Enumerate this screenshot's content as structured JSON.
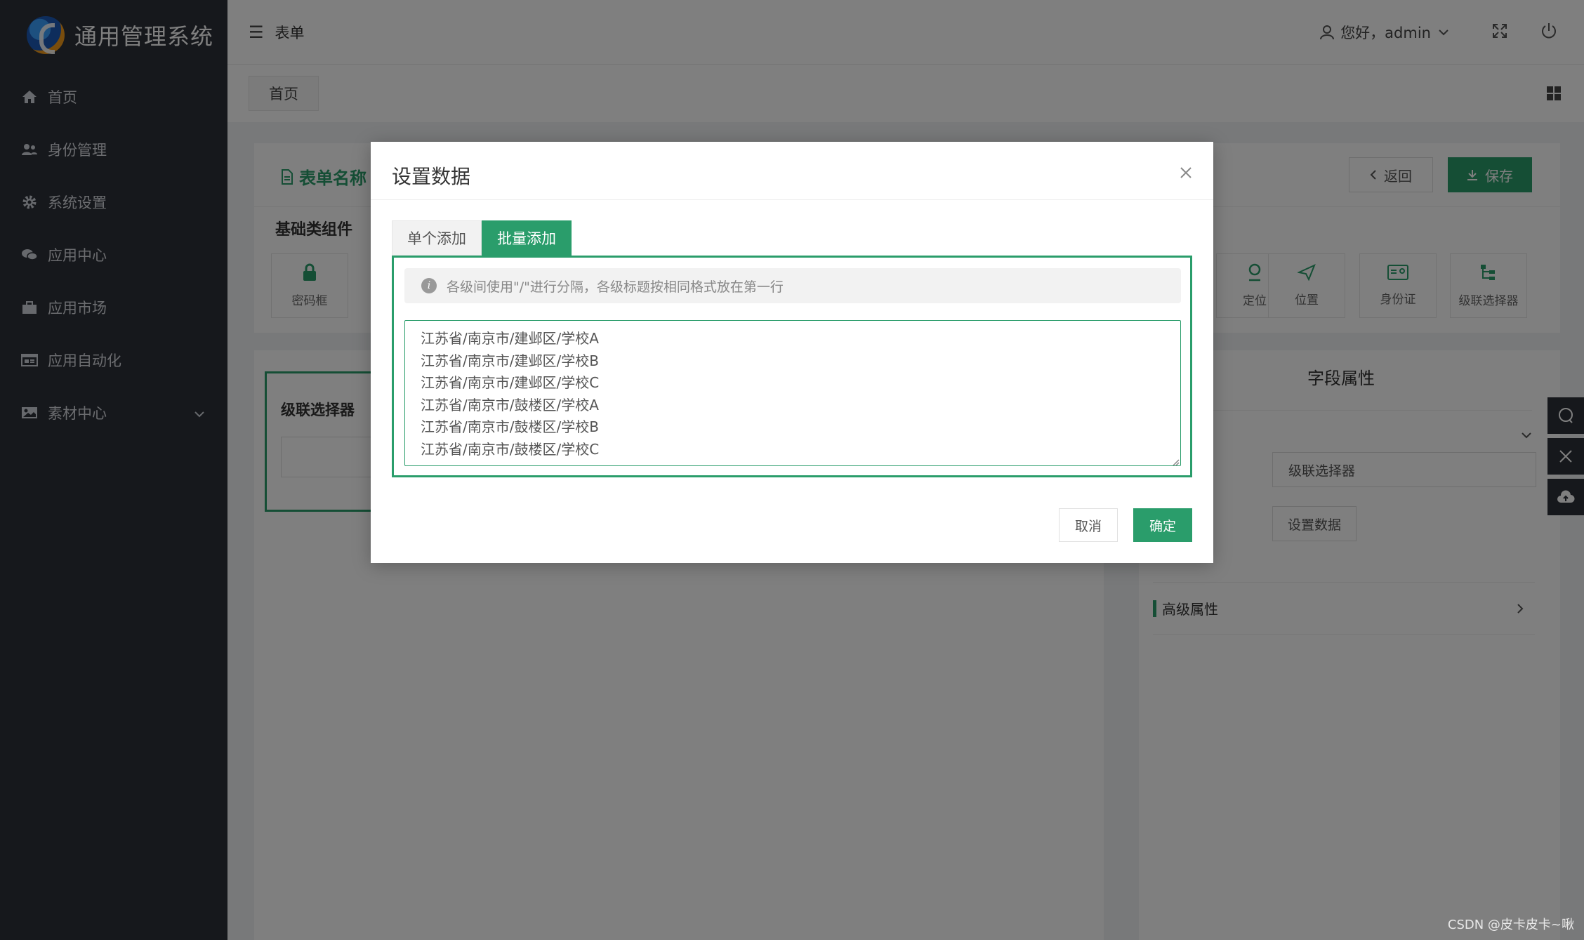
{
  "brand": {
    "title": "通用管理系统"
  },
  "sidebar": {
    "items": [
      {
        "label": "首页",
        "icon": "home-icon"
      },
      {
        "label": "身份管理",
        "icon": "users-icon"
      },
      {
        "label": "系统设置",
        "icon": "gear-icon"
      },
      {
        "label": "应用中心",
        "icon": "chat-icon"
      },
      {
        "label": "应用市场",
        "icon": "bag-icon"
      },
      {
        "label": "应用自动化",
        "icon": "browser-icon"
      },
      {
        "label": "素材中心",
        "icon": "image-icon"
      }
    ]
  },
  "header": {
    "breadcrumb": "表单",
    "greeting": "您好，admin"
  },
  "tabs": {
    "home": "首页"
  },
  "form": {
    "name": "表单名称",
    "back_label": "返回",
    "save_label": "保存",
    "component_group": "基础类组件",
    "components": [
      "密码框",
      "定位",
      "位置",
      "身份证",
      "级联选择器"
    ],
    "canvas_field_label": "级联选择器",
    "props_title": "字段属性",
    "props_field_value": "级联选择器",
    "props_set_data_button": "设置数据",
    "advanced_label": "高级属性"
  },
  "dialog": {
    "title": "设置数据",
    "tabs": [
      "单个添加",
      "批量添加"
    ],
    "active_tab": "批量添加",
    "tip": "各级间使用\"/\"进行分隔，各级标题按相同格式放在第一行",
    "textarea_value": "江苏省/南京市/建邺区/学校A\n江苏省/南京市/建邺区/学校B\n江苏省/南京市/建邺区/学校C\n江苏省/南京市/鼓楼区/学校A\n江苏省/南京市/鼓楼区/学校B\n江苏省/南京市/鼓楼区/学校C",
    "cancel_label": "取消",
    "ok_label": "确定"
  },
  "watermark": "CSDN @皮卡皮卡~啾",
  "colors": {
    "accent": "#2a9d6b",
    "sidebar": "#2c3038"
  }
}
